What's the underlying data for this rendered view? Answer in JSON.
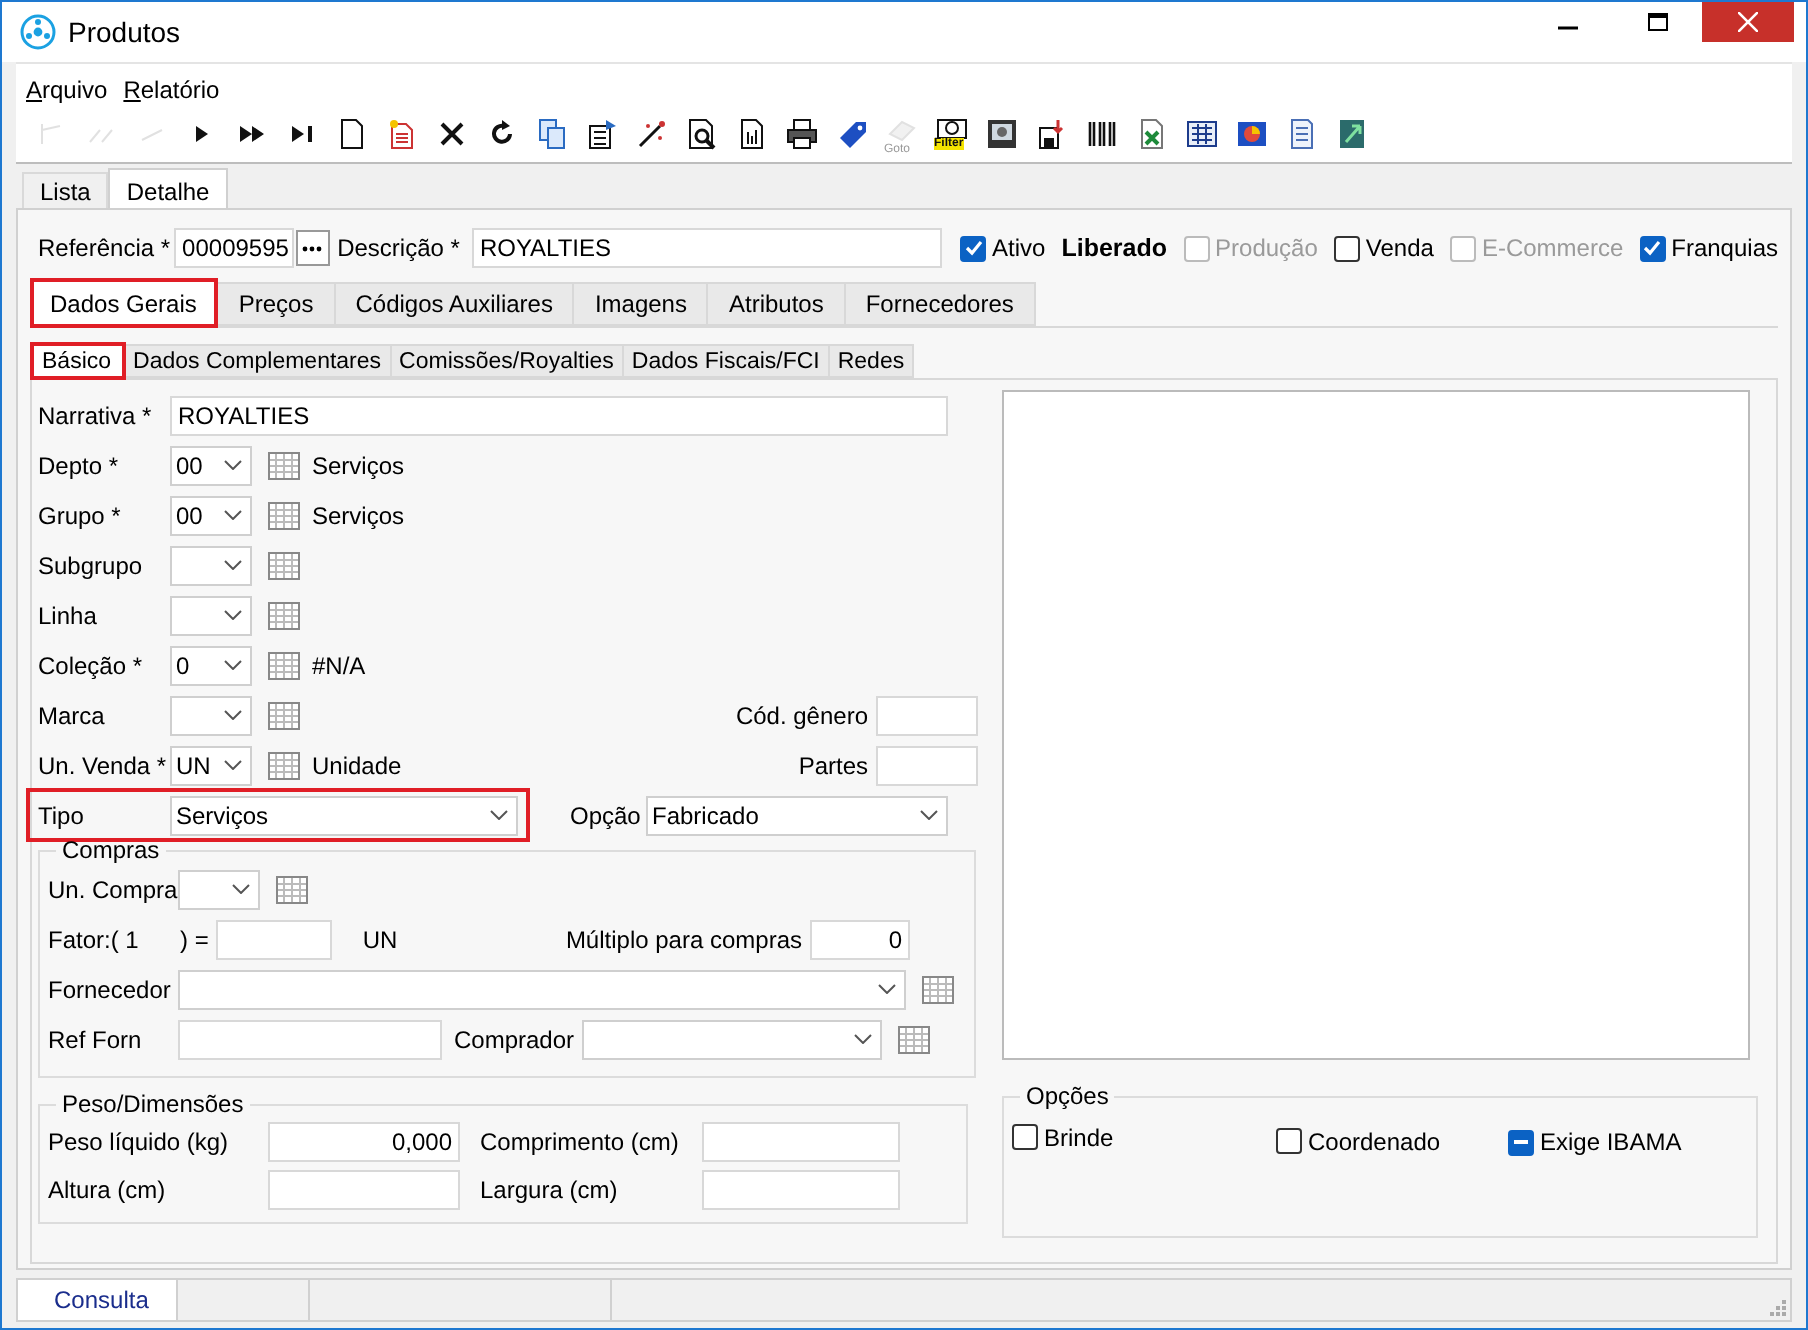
{
  "window": {
    "title": "Produtos"
  },
  "menu": [
    {
      "label": "Arquivo"
    },
    {
      "label": "Relatório"
    }
  ],
  "toolbar": [
    {
      "kind": "first",
      "disabled": true
    },
    {
      "kind": "prev_page",
      "disabled": true
    },
    {
      "kind": "prev",
      "disabled": true
    },
    {
      "kind": "next",
      "disabled": false
    },
    {
      "kind": "next_page",
      "disabled": false
    },
    {
      "kind": "last",
      "disabled": false
    },
    {
      "kind": "new",
      "disabled": false
    },
    {
      "kind": "edit",
      "disabled": false
    },
    {
      "kind": "delete",
      "disabled": false
    },
    {
      "kind": "refresh",
      "disabled": false
    },
    {
      "kind": "copy",
      "disabled": false
    },
    {
      "kind": "properties",
      "disabled": false
    },
    {
      "kind": "wand",
      "disabled": false
    },
    {
      "kind": "preview",
      "disabled": false
    },
    {
      "kind": "report",
      "disabled": false
    },
    {
      "kind": "print",
      "disabled": false
    },
    {
      "kind": "tag",
      "disabled": false
    },
    {
      "kind": "goto",
      "disabled": true,
      "caption": "Goto"
    },
    {
      "kind": "filter",
      "disabled": false,
      "caption": "Filter"
    },
    {
      "kind": "image",
      "disabled": false
    },
    {
      "kind": "import",
      "disabled": false
    },
    {
      "kind": "barcode",
      "disabled": false
    },
    {
      "kind": "excel",
      "disabled": false
    },
    {
      "kind": "calc",
      "disabled": false
    },
    {
      "kind": "chart",
      "disabled": false
    },
    {
      "kind": "list",
      "disabled": false
    },
    {
      "kind": "exit",
      "disabled": false
    }
  ],
  "main_tabs": [
    {
      "label": "Lista",
      "selected": false
    },
    {
      "label": "Detalhe",
      "selected": true
    }
  ],
  "header": {
    "referencia": {
      "label": "Referência *",
      "value": "00009595"
    },
    "descricao": {
      "label": "Descrição *",
      "value": "ROYALTIES"
    },
    "flags": [
      {
        "kind": "checkbox",
        "label": "Ativo",
        "checked": true,
        "disabled": false
      },
      {
        "kind": "status",
        "label": "Liberado"
      },
      {
        "kind": "checkbox",
        "label": "Produção",
        "checked": false,
        "disabled": true
      },
      {
        "kind": "checkbox",
        "label": "Venda",
        "checked": false,
        "disabled": false
      },
      {
        "kind": "checkbox",
        "label": "E-Commerce",
        "checked": false,
        "disabled": true
      },
      {
        "kind": "checkbox",
        "label": "Franquias",
        "checked": true,
        "disabled": false
      }
    ]
  },
  "section_tabs": [
    {
      "label": "Dados Gerais",
      "selected": true,
      "highlighted": true
    },
    {
      "label": "Preços",
      "selected": false,
      "highlighted": false
    },
    {
      "label": "Códigos Auxiliares",
      "selected": false,
      "highlighted": false
    },
    {
      "label": "Imagens",
      "selected": false,
      "highlighted": false
    },
    {
      "label": "Atributos",
      "selected": false,
      "highlighted": false
    },
    {
      "label": "Fornecedores",
      "selected": false,
      "highlighted": false
    }
  ],
  "sub_tabs": [
    {
      "label": "Básico",
      "selected": true,
      "highlighted": true
    },
    {
      "label": "Dados Complementares",
      "selected": false,
      "highlighted": false
    },
    {
      "label": "Comissões/Royalties",
      "selected": false,
      "highlighted": false
    },
    {
      "label": "Dados Fiscais/FCI",
      "selected": false,
      "highlighted": false
    },
    {
      "label": "Redes",
      "selected": false,
      "highlighted": false
    }
  ],
  "narrativa": {
    "label": "Narrativa *",
    "value": "ROYALTIES"
  },
  "lookups": [
    {
      "label": "Depto *",
      "code": "00",
      "description": "Serviços"
    },
    {
      "label": "Grupo *",
      "code": "00",
      "description": "Serviços"
    },
    {
      "label": "Subgrupo"
    },
    {
      "label": "Linha"
    },
    {
      "label": "Coleção *",
      "code": "0",
      "description": "#N/A"
    },
    {
      "label": "Marca",
      "side": {
        "label": "Cód. gênero"
      }
    },
    {
      "label": "Un. Venda *",
      "code": "UN",
      "description": "Unidade",
      "side": {
        "label": "Partes"
      }
    }
  ],
  "tipo": {
    "label": "Tipo",
    "value": "Serviços",
    "highlighted": true
  },
  "opcao": {
    "label": "Opção",
    "value": "Fabricado"
  },
  "compras": {
    "title": "Compras",
    "un_compra": {
      "label": "Un. Compra"
    },
    "fator": {
      "label": "Fator:( 1",
      "label_end": ") =",
      "unit": "UN"
    },
    "multiplo": {
      "label": "Múltiplo para compras",
      "value": "0"
    },
    "fornecedor": {
      "label": "Fornecedor"
    },
    "ref_forn": {
      "label": "Ref Forn"
    },
    "comprador": {
      "label": "Comprador"
    }
  },
  "peso": {
    "title": "Peso/Dimensões",
    "fields": [
      {
        "label": "Peso líquido (kg)",
        "value": "0,000"
      },
      {
        "label": "Comprimento (cm)"
      },
      {
        "label": "Altura (cm)"
      },
      {
        "label": "Largura (cm)"
      }
    ]
  },
  "opcoes": {
    "title": "Opções",
    "items": [
      {
        "label": "Brinde",
        "indeterminate": false
      },
      {
        "label": "Coordenado",
        "indeterminate": false
      },
      {
        "label": "Exige IBAMA",
        "indeterminate": true
      }
    ]
  },
  "status_bar": {
    "panels": [
      "Consulta"
    ]
  }
}
